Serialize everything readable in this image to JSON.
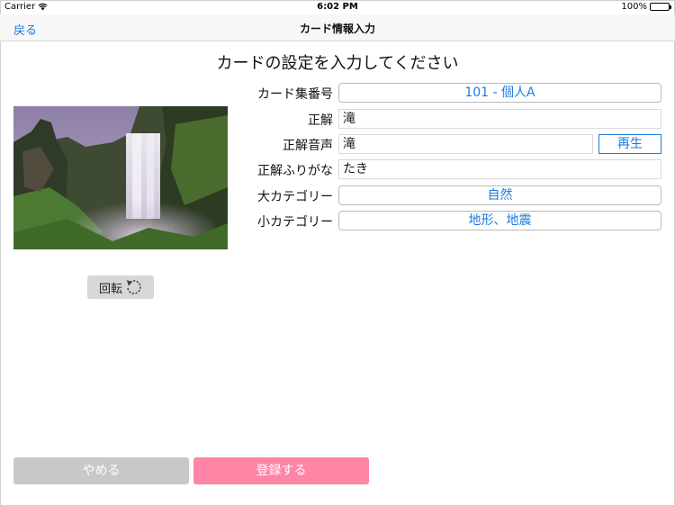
{
  "status_bar": {
    "carrier": "Carrier",
    "time": "6:02 PM",
    "battery": "100%"
  },
  "nav": {
    "back_label": "戻る",
    "title": "カード情報入力"
  },
  "heading": "カードの設定を入力してください",
  "image": {
    "rotate_label": "回転"
  },
  "form": {
    "card_set": {
      "label": "カード集番号",
      "value": "101 - 個人A"
    },
    "answer": {
      "label": "正解",
      "value": "滝"
    },
    "answer_audio": {
      "label": "正解音声",
      "value": "滝",
      "play_label": "再生"
    },
    "answer_furigana": {
      "label": "正解ふりがな",
      "value": "たき"
    },
    "major_category": {
      "label": "大カテゴリー",
      "value": "自然"
    },
    "minor_category": {
      "label": "小カテゴリー",
      "value": "地形、地震"
    }
  },
  "actions": {
    "cancel_label": "やめる",
    "register_label": "登録する"
  },
  "colors": {
    "accent": "#1a7be0",
    "register": "#ff84a5",
    "cancel": "#c8c8c8"
  }
}
